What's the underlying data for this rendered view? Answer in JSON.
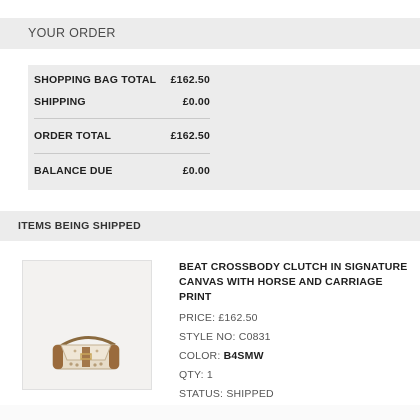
{
  "order_header": {
    "title": "YOUR ORDER"
  },
  "summary": {
    "rows": [
      {
        "label": "SHOPPING BAG TOTAL",
        "value": "£162.50"
      },
      {
        "label": "SHIPPING",
        "value": "£0.00"
      },
      {
        "label": "ORDER TOTAL",
        "value": "£162.50"
      },
      {
        "label": "BALANCE DUE",
        "value": "£0.00"
      }
    ]
  },
  "shipping": {
    "title": "ITEMS BEING SHIPPED"
  },
  "product": {
    "name": "BEAT CROSSBODY CLUTCH IN SIGNATURE CANVAS WITH HORSE AND CARRIAGE PRINT",
    "price_label": "PRICE:",
    "price_value": "£162.50",
    "style_label": "STYLE NO:",
    "style_value": "C0831",
    "color_label": "COLOR:",
    "color_value": "B4SMW",
    "qty_label": "QTY:",
    "qty_value": "1",
    "status_label": "STATUS:",
    "status_value": "SHIPPED",
    "image_icon": "handbag-photo"
  },
  "colors": {
    "panel_gray": "#ececec",
    "text_dark": "#1f1f1f",
    "text_muted": "#555555"
  }
}
